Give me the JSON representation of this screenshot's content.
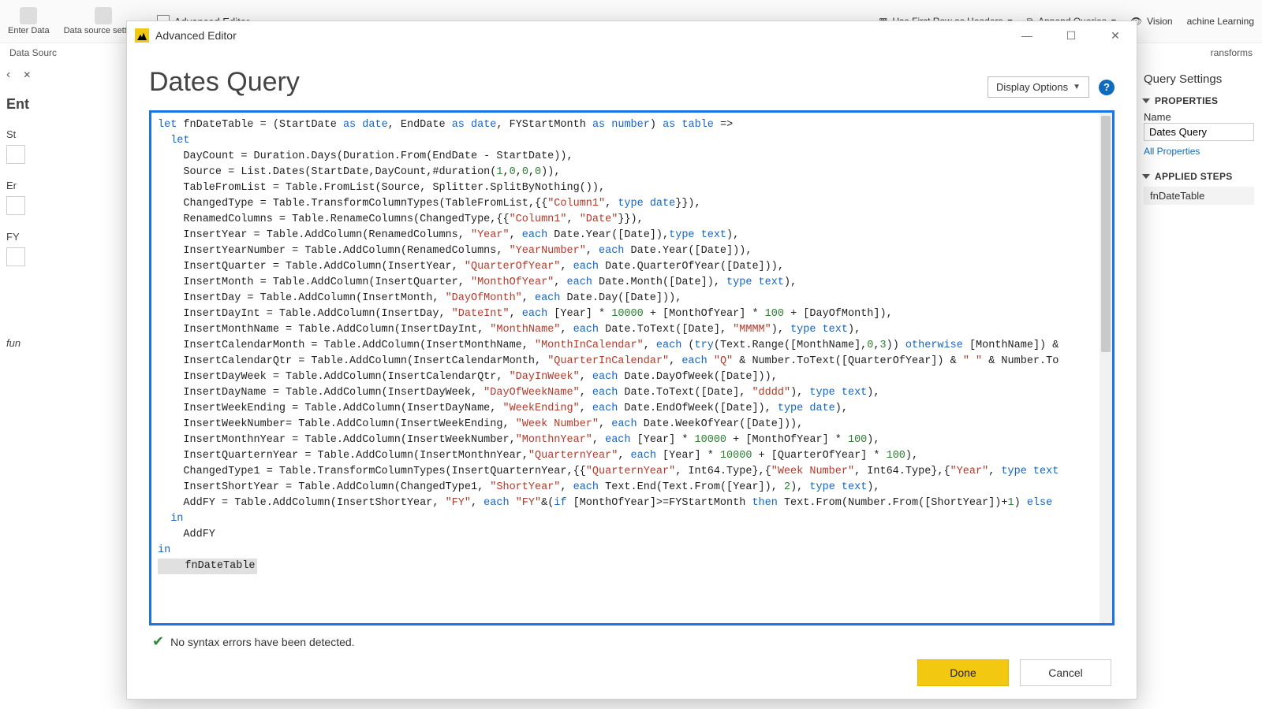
{
  "ribbon": {
    "enter_data": "Enter\nData",
    "data_source_settings": "Data source\nsettings",
    "advanced_editor": "Advanced Editor",
    "use_first_row": "Use First Row as Headers",
    "append_queries": "Append Queries",
    "vision": "Vision",
    "machine_learning": "achine Learning"
  },
  "secondbar": {
    "left": "Data Sourc",
    "right": "ransforms"
  },
  "left": {
    "enter_heading": "Ent",
    "st": "St",
    "er": "Er",
    "fy": "FY",
    "fun": "fun"
  },
  "right": {
    "title": "Query Settings",
    "properties": "PROPERTIES",
    "name_label": "Name",
    "name_value": "Dates Query",
    "all_properties": "All Properties",
    "applied_steps": "APPLIED STEPS",
    "step1": "fnDateTable"
  },
  "modal": {
    "title": "Advanced Editor",
    "heading": "Dates Query",
    "display_options": "Display Options",
    "status": "No syntax errors have been detected.",
    "done": "Done",
    "cancel": "Cancel"
  },
  "code": {
    "l01a": "let",
    "l01b": " fnDateTable = (StartDate ",
    "l01c": "as",
    "l01d": " ",
    "l01e": "date",
    "l01f": ", EndDate ",
    "l01g": "as",
    "l01h": " ",
    "l01i": "date",
    "l01j": ", FYStartMonth ",
    "l01k": "as",
    "l01l": " ",
    "l01m": "number",
    "l01n": ") ",
    "l01o": "as",
    "l01p": " ",
    "l01q": "table",
    "l01r": " =>",
    "l02": "  let",
    "l03": "    DayCount = Duration.Days(Duration.From(EndDate - StartDate)),",
    "l04a": "    Source = List.Dates(StartDate,DayCount,#duration(",
    "l04b": "1",
    "l04c": ",",
    "l04d": "0",
    "l04e": ",",
    "l04f": "0",
    "l04g": ",",
    "l04h": "0",
    "l04i": ")),",
    "l05": "    TableFromList = Table.FromList(Source, Splitter.SplitByNothing()),",
    "l06a": "    ChangedType = Table.TransformColumnTypes(TableFromList,{{",
    "l06b": "\"Column1\"",
    "l06c": ", ",
    "l06d": "type date",
    "l06e": "}}),",
    "l07a": "    RenamedColumns = Table.RenameColumns(ChangedType,{{",
    "l07b": "\"Column1\"",
    "l07c": ", ",
    "l07d": "\"Date\"",
    "l07e": "}}),",
    "l08a": "    InsertYear = Table.AddColumn(RenamedColumns, ",
    "l08b": "\"Year\"",
    "l08c": ", ",
    "l08d": "each",
    "l08e": " Date.Year([Date]),",
    "l08f": "type text",
    "l08g": "),",
    "l09a": "    InsertYearNumber = Table.AddColumn(RenamedColumns, ",
    "l09b": "\"YearNumber\"",
    "l09c": ", ",
    "l09d": "each",
    "l09e": " Date.Year([Date])),",
    "l10a": "    InsertQuarter = Table.AddColumn(InsertYear, ",
    "l10b": "\"QuarterOfYear\"",
    "l10c": ", ",
    "l10d": "each",
    "l10e": " Date.QuarterOfYear([Date])),",
    "l11a": "    InsertMonth = Table.AddColumn(InsertQuarter, ",
    "l11b": "\"MonthOfYear\"",
    "l11c": ", ",
    "l11d": "each",
    "l11e": " Date.Month([Date]), ",
    "l11f": "type text",
    "l11g": "),",
    "l12a": "    InsertDay = Table.AddColumn(InsertMonth, ",
    "l12b": "\"DayOfMonth\"",
    "l12c": ", ",
    "l12d": "each",
    "l12e": " Date.Day([Date])),",
    "l13a": "    InsertDayInt = Table.AddColumn(InsertDay, ",
    "l13b": "\"DateInt\"",
    "l13c": ", ",
    "l13d": "each",
    "l13e": " [Year] * ",
    "l13f": "10000",
    "l13g": " + [MonthOfYear] * ",
    "l13h": "100",
    "l13i": " + [DayOfMonth]),",
    "l14a": "    InsertMonthName = Table.AddColumn(InsertDayInt, ",
    "l14b": "\"MonthName\"",
    "l14c": ", ",
    "l14d": "each",
    "l14e": " Date.ToText([Date], ",
    "l14f": "\"MMMM\"",
    "l14g": "), ",
    "l14h": "type text",
    "l14i": "),",
    "l15a": "    InsertCalendarMonth = Table.AddColumn(InsertMonthName, ",
    "l15b": "\"MonthInCalendar\"",
    "l15c": ", ",
    "l15d": "each",
    "l15e": " (",
    "l15f": "try",
    "l15g": "(Text.Range([MonthName],",
    "l15h": "0",
    "l15i": ",",
    "l15j": "3",
    "l15k": ")) ",
    "l15l": "otherwise",
    "l15m": " [MonthName]) &",
    "l16a": "    InsertCalendarQtr = Table.AddColumn(InsertCalendarMonth, ",
    "l16b": "\"QuarterInCalendar\"",
    "l16c": ", ",
    "l16d": "each",
    "l16e": " ",
    "l16f": "\"Q\"",
    "l16g": " & Number.ToText([QuarterOfYear]) & ",
    "l16h": "\" \"",
    "l16i": " & Number.To",
    "l17a": "    InsertDayWeek = Table.AddColumn(InsertCalendarQtr, ",
    "l17b": "\"DayInWeek\"",
    "l17c": ", ",
    "l17d": "each",
    "l17e": " Date.DayOfWeek([Date])),",
    "l18a": "    InsertDayName = Table.AddColumn(InsertDayWeek, ",
    "l18b": "\"DayOfWeekName\"",
    "l18c": ", ",
    "l18d": "each",
    "l18e": " Date.ToText([Date], ",
    "l18f": "\"dddd\"",
    "l18g": "), ",
    "l18h": "type text",
    "l18i": "),",
    "l19a": "    InsertWeekEnding = Table.AddColumn(InsertDayName, ",
    "l19b": "\"WeekEnding\"",
    "l19c": ", ",
    "l19d": "each",
    "l19e": " Date.EndOfWeek([Date]), ",
    "l19f": "type date",
    "l19g": "),",
    "l20a": "    InsertWeekNumber= Table.AddColumn(InsertWeekEnding, ",
    "l20b": "\"Week Number\"",
    "l20c": ", ",
    "l20d": "each",
    "l20e": " Date.WeekOfYear([Date])),",
    "l21a": "    InsertMonthnYear = Table.AddColumn(InsertWeekNumber,",
    "l21b": "\"MonthnYear\"",
    "l21c": ", ",
    "l21d": "each",
    "l21e": " [Year] * ",
    "l21f": "10000",
    "l21g": " + [MonthOfYear] * ",
    "l21h": "100",
    "l21i": "),",
    "l22a": "    InsertQuarternYear = Table.AddColumn(InsertMonthnYear,",
    "l22b": "\"QuarternYear\"",
    "l22c": ", ",
    "l22d": "each",
    "l22e": " [Year] * ",
    "l22f": "10000",
    "l22g": " + [QuarterOfYear] * ",
    "l22h": "100",
    "l22i": "),",
    "l23a": "    ChangedType1 = Table.TransformColumnTypes(InsertQuarternYear,{{",
    "l23b": "\"QuarternYear\"",
    "l23c": ", Int64.Type},{",
    "l23d": "\"Week Number\"",
    "l23e": ", Int64.Type},{",
    "l23f": "\"Year\"",
    "l23g": ", ",
    "l23h": "type text",
    "l24a": "    InsertShortYear = Table.AddColumn(ChangedType1, ",
    "l24b": "\"ShortYear\"",
    "l24c": ", ",
    "l24d": "each",
    "l24e": " Text.End(Text.From([Year]), ",
    "l24f": "2",
    "l24g": "), ",
    "l24h": "type text",
    "l24i": "),",
    "l25a": "    AddFY = Table.AddColumn(InsertShortYear, ",
    "l25b": "\"FY\"",
    "l25c": ", ",
    "l25d": "each",
    "l25e": " ",
    "l25f": "\"FY\"",
    "l25g": "&(",
    "l25h": "if",
    "l25i": " [MonthOfYear]>=FYStartMonth ",
    "l25j": "then",
    "l25k": " Text.From(Number.From([ShortYear])+",
    "l25l": "1",
    "l25m": ") ",
    "l25n": "else",
    "l26": "  in",
    "l27": "    AddFY",
    "l28": "in",
    "l29": "    fnDateTable"
  }
}
